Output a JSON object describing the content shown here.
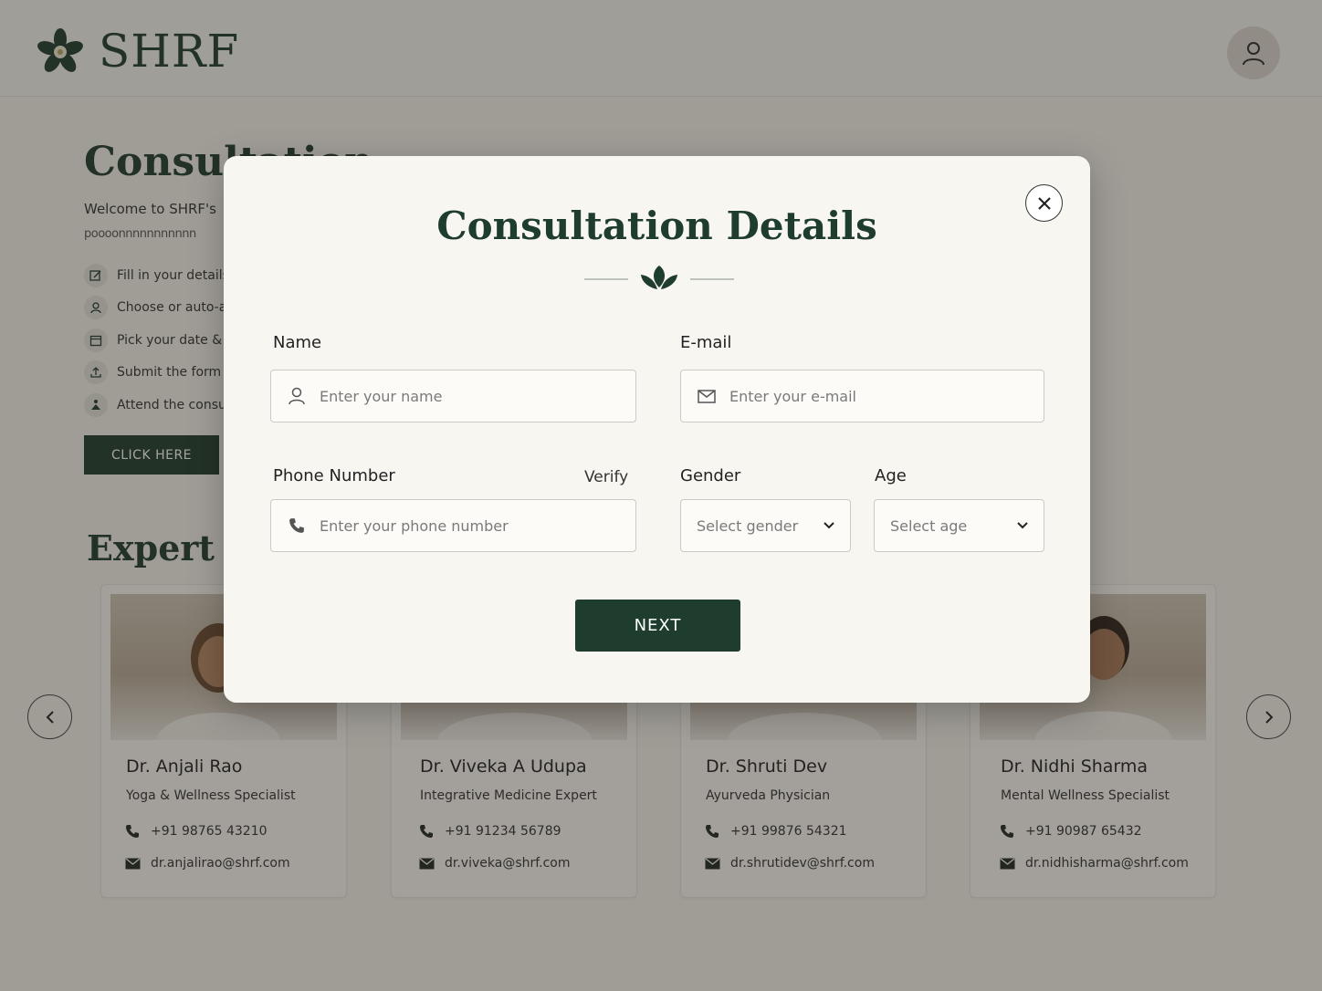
{
  "header": {
    "logo_text": "SHRF"
  },
  "background": {
    "title": "Consultation",
    "welcome": "Welcome to SHRF's",
    "para": "poooonnnnnnnnnnn",
    "steps": [
      {
        "label": "Fill in your details",
        "icon": "edit-icon"
      },
      {
        "label": "Choose or auto-a",
        "icon": "user-icon"
      },
      {
        "label": "Pick your date &",
        "icon": "calendar-icon"
      },
      {
        "label": "Submit the form",
        "icon": "upload-icon"
      },
      {
        "label": "Attend the consu",
        "icon": "meditation-icon"
      }
    ],
    "click_label": "CLICK HERE",
    "experts_title": "Expert Doctors"
  },
  "doctors": [
    {
      "name": "Dr. Anjali Rao",
      "role": "Yoga & Wellness Specialist",
      "phone": "+91 98765 43210",
      "email": "dr.anjalirao@shrf.com"
    },
    {
      "name": "Dr. Viveka A Udupa",
      "role": "Integrative Medicine Expert",
      "phone": "+91 91234 56789",
      "email": "dr.viveka@shrf.com"
    },
    {
      "name": "Dr. Shruti Dev",
      "role": "Ayurveda Physician",
      "phone": "+91 99876 54321",
      "email": "dr.shrutidev@shrf.com"
    },
    {
      "name": "Dr. Nidhi Sharma",
      "role": "Mental Wellness Specialist",
      "phone": "+91 90987 65432",
      "email": "dr.nidhisharma@shrf.com"
    }
  ],
  "modal": {
    "title": "Consultation Details",
    "name_label": "Name",
    "name_placeholder": "Enter your name",
    "email_label": "E-mail",
    "email_placeholder": "Enter your e-mail",
    "phone_label": "Phone Number",
    "verify_label": "Verify",
    "phone_placeholder": "Enter your phone number",
    "gender_label": "Gender",
    "gender_value": "Select gender",
    "age_label": "Age",
    "age_value": "Select age",
    "next_label": "NEXT"
  },
  "colors": {
    "brand_green": "#1f3d2e",
    "modal_bg": "#f8f6f1",
    "overlay": "rgba(40,36,28,0.42)"
  }
}
